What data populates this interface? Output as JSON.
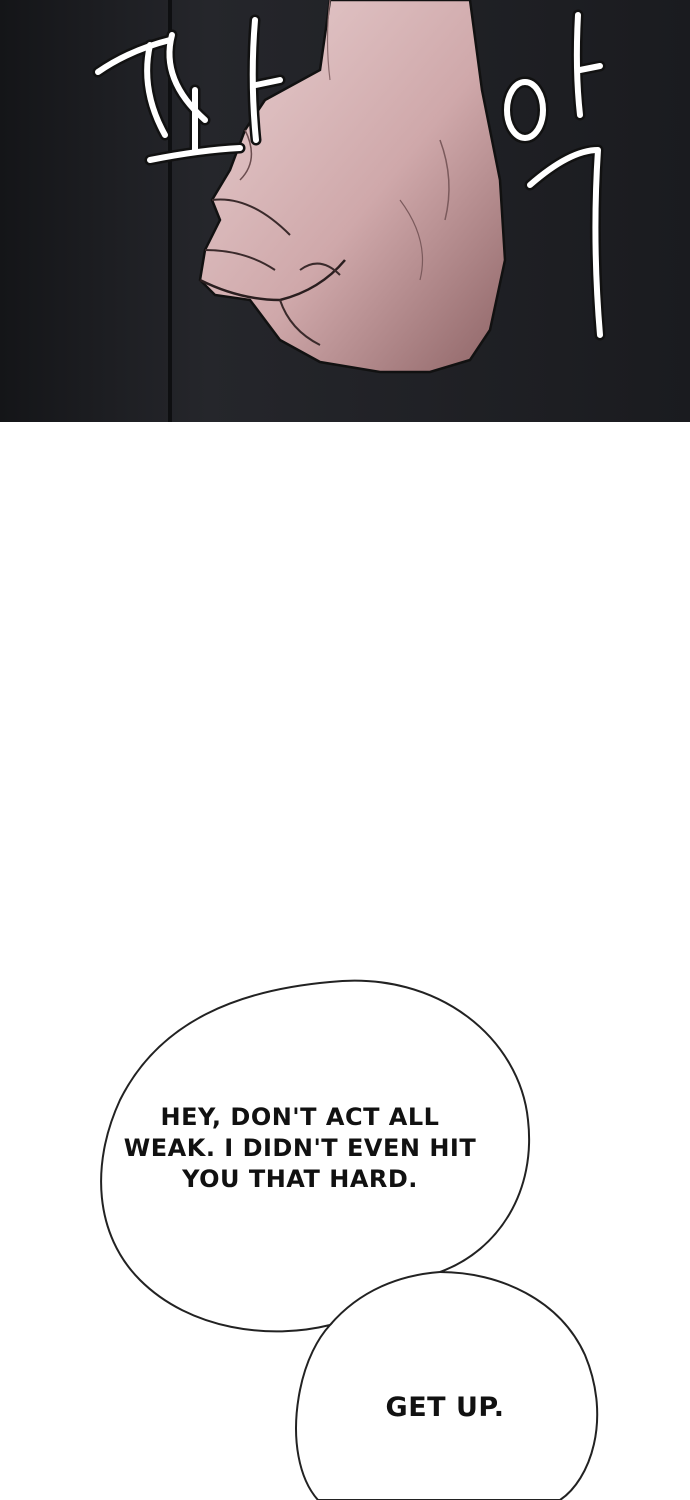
{
  "panel": {
    "sfx_chars": [
      "짜",
      "악"
    ],
    "colors": {
      "background": "#1c1d21",
      "skin": "#d6b3b5",
      "skin_shadow": "#a97f80",
      "outline": "#111111"
    }
  },
  "bubbles": {
    "speech_1": [
      "HEY, DON'T ACT ALL",
      "WEAK. I DIDN'T EVEN HIT",
      "YOU THAT HARD."
    ],
    "speech_2": "GET UP."
  }
}
